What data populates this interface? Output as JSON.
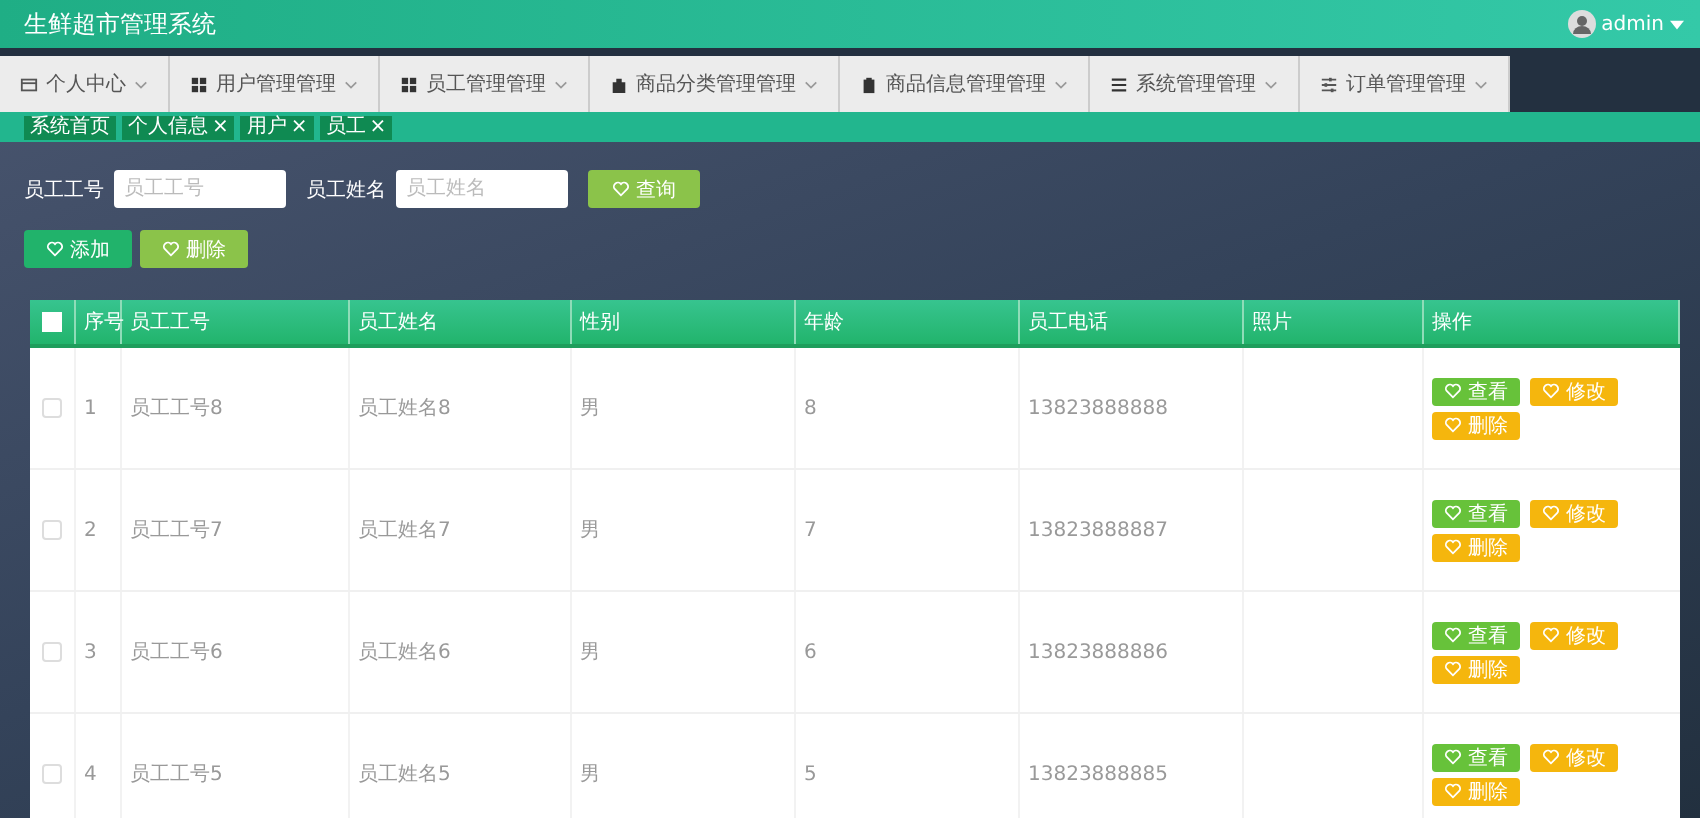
{
  "header": {
    "title": "生鲜超市管理系统",
    "user": "admin"
  },
  "nav": [
    {
      "label": "个人中心"
    },
    {
      "label": "用户管理管理"
    },
    {
      "label": "员工管理管理"
    },
    {
      "label": "商品分类管理管理"
    },
    {
      "label": "商品信息管理管理"
    },
    {
      "label": "系统管理管理"
    },
    {
      "label": "订单管理管理"
    }
  ],
  "tags": [
    {
      "label": "系统首页"
    },
    {
      "label": "个人信息",
      "close": "×"
    },
    {
      "label": "用户",
      "close": "×"
    },
    {
      "label": "员工",
      "close": "×"
    }
  ],
  "search": [
    {
      "label": "员工工号",
      "placeholder": "员工工号"
    },
    {
      "label": "员工姓名",
      "placeholder": "员工姓名"
    }
  ],
  "search_button": "查询",
  "actions": [
    {
      "label": "添加",
      "kind": "add"
    },
    {
      "label": "删除",
      "kind": "delete"
    }
  ],
  "table": {
    "select_all": false,
    "columns": [
      "序号",
      "员工工号",
      "员工姓名",
      "性别",
      "年龄",
      "员工电话",
      "照片",
      "操作"
    ],
    "rows": [
      {
        "checked": false,
        "cells": [
          "1",
          "员工工号8",
          "员工姓名8",
          "男",
          "8",
          "13823888888",
          ""
        ],
        "buttons": [
          {
            "label": "查看",
            "kind": "view"
          },
          {
            "label": "修改",
            "kind": "edit"
          },
          {
            "label": "删除",
            "kind": "remove"
          }
        ]
      },
      {
        "checked": false,
        "cells": [
          "2",
          "员工工号7",
          "员工姓名7",
          "男",
          "7",
          "13823888887",
          ""
        ],
        "buttons": [
          {
            "label": "查看",
            "kind": "view"
          },
          {
            "label": "修改",
            "kind": "edit"
          },
          {
            "label": "删除",
            "kind": "remove"
          }
        ]
      },
      {
        "checked": false,
        "cells": [
          "3",
          "员工工号6",
          "员工姓名6",
          "男",
          "6",
          "13823888886",
          ""
        ],
        "buttons": [
          {
            "label": "查看",
            "kind": "view"
          },
          {
            "label": "修改",
            "kind": "edit"
          },
          {
            "label": "删除",
            "kind": "remove"
          }
        ]
      },
      {
        "checked": false,
        "cells": [
          "4",
          "员工工号5",
          "员工姓名5",
          "男",
          "5",
          "13823888885",
          ""
        ],
        "buttons": [
          {
            "label": "查看",
            "kind": "view"
          },
          {
            "label": "修改",
            "kind": "edit"
          },
          {
            "label": "删除",
            "kind": "remove"
          }
        ]
      }
    ]
  }
}
